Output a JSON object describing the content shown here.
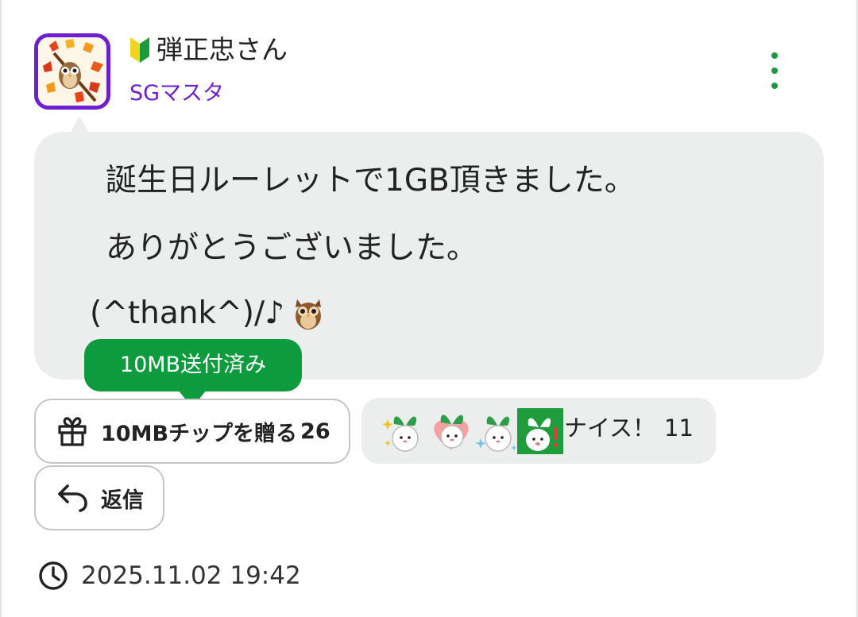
{
  "post": {
    "username": "弾正忠さん",
    "rank": "SGマスタ",
    "message_lines": [
      "誕生日ルーレットで1GB頂きました。",
      "ありがとうございました。",
      "(^thank^)/♪"
    ],
    "sent_badge": "10MB送付済み",
    "tip_button": {
      "label": "10MBチップを贈る",
      "count": "26"
    },
    "reaction": {
      "label": "ナイス！",
      "count": "11",
      "stamps": [
        "radish-sparkle-stamp",
        "radish-heart-stamp",
        "radish-sparkle-stamp-2",
        "radish-surprise-stamp"
      ]
    },
    "reply_button": {
      "label": "返信"
    },
    "timestamp": "2025.11.02 19:42"
  },
  "icons": {
    "beginner": "beginner-mark-icon",
    "avatar": "autumn-owl-avatar",
    "more": "more-vertical-icon",
    "gift": "gift-icon",
    "reply": "reply-icon",
    "clock": "clock-icon",
    "owl_emoji": "owl-emoji"
  },
  "colors": {
    "accent_green": "#0d9b3d",
    "rank_purple": "#6c1fd0",
    "bubble_bg": "#ebeeec"
  }
}
